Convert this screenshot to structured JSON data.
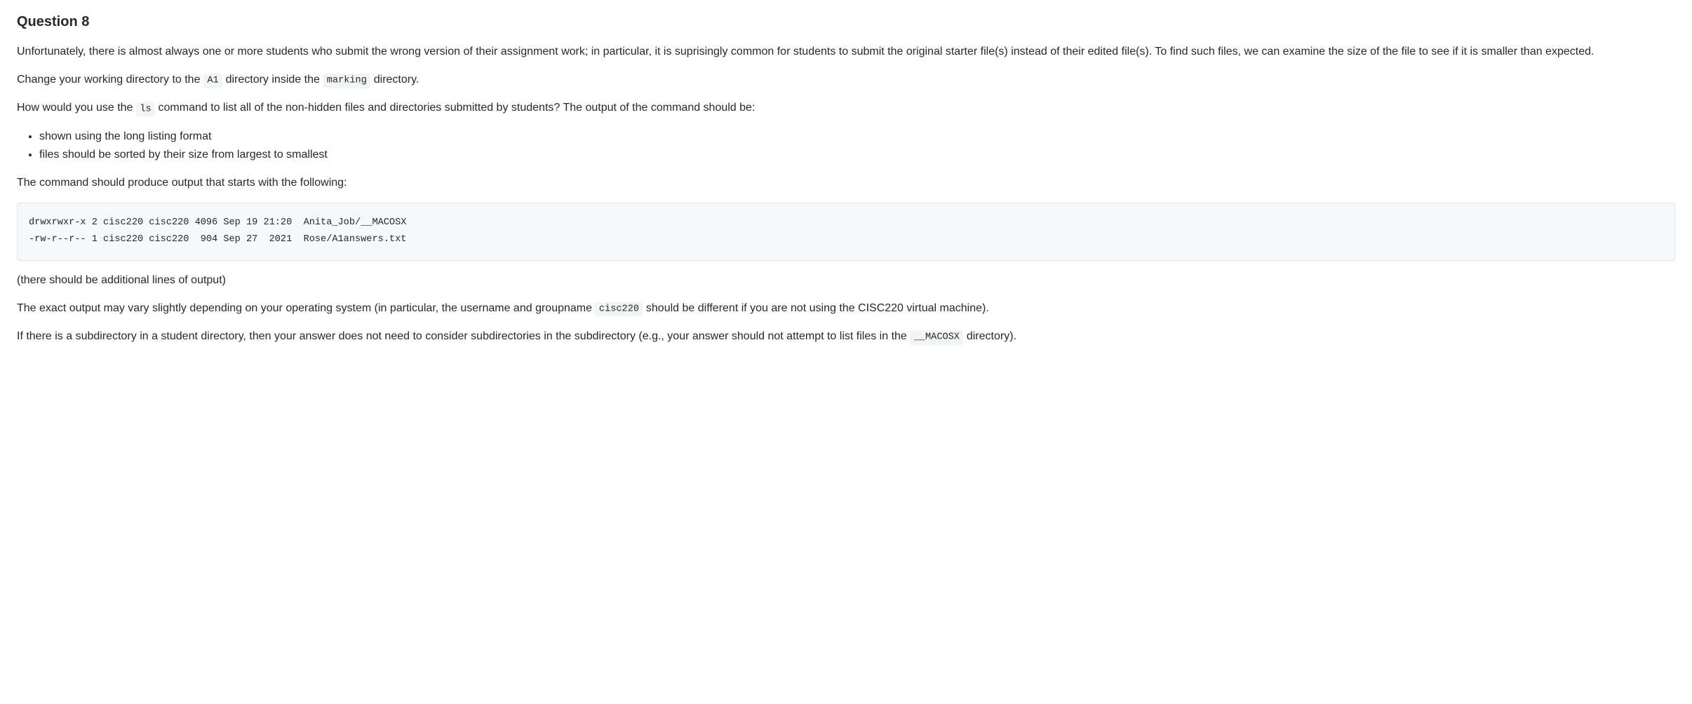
{
  "heading": "Question 8",
  "p1a": "Unfortunately, there is almost always one or more students who submit the wrong version of their assignment work; in particular, it is suprisingly common for students to submit the original starter file(s) instead of their edited file(s). To find such files, we can examine the size of the file to see if it is smaller than expected.",
  "p2": {
    "a": "Change your working directory to the ",
    "code1": "A1",
    "b": " directory inside the ",
    "code2": "marking",
    "c": " directory."
  },
  "p3": {
    "a": "How would you use the ",
    "code1": "ls",
    "b": " command to list all of the non-hidden files and directories submitted by students? The output of the command should be:"
  },
  "list": {
    "item1": "shown using the long listing format",
    "item2": "files should be sorted by their size from largest to smallest"
  },
  "p4": "The command should produce output that starts with the following:",
  "codeblock": "drwxrwxr-x 2 cisc220 cisc220 4096 Sep 19 21:20  Anita_Job/__MACOSX\n-rw-r--r-- 1 cisc220 cisc220  904 Sep 27  2021  Rose/A1answers.txt",
  "p5": "(there should be additional lines of output)",
  "p6": {
    "a": "The exact output may vary slightly depending on your operating system (in particular, the username and groupname ",
    "code1": "cisc220",
    "b": " should be different if you are not using the CISC220 virtual machine)."
  },
  "p7": {
    "a": "If there is a subdirectory in a student directory, then your answer does not need to consider subdirectories in the subdirectory (e.g., your answer should not attempt to list files in the ",
    "code1": "__MACOSX",
    "b": " directory)."
  }
}
